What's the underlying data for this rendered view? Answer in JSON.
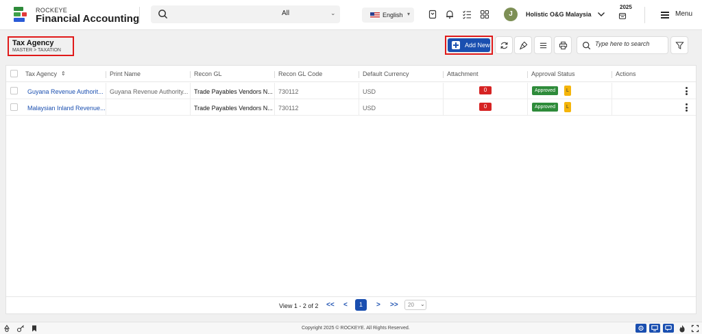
{
  "app": {
    "brand_small": "ROCKEYE",
    "brand_main": "Financial Accounting"
  },
  "topbar": {
    "search_scope": "All",
    "language": "English",
    "avatar_initial": "J",
    "company": "Holistic O&G Malaysia",
    "year": "2025",
    "menu_label": "Menu"
  },
  "page": {
    "title": "Tax Agency",
    "breadcrumb": "MASTER  >  TAXATION",
    "add_new_label": "Add New",
    "search_placeholder": "Type here to search"
  },
  "table": {
    "columns": [
      "Tax Agency",
      "Print Name",
      "Recon GL",
      "Recon GL Code",
      "Default Currency",
      "Attachment",
      "Approval Status",
      "Actions"
    ],
    "sort_indicator": "⇕",
    "rows": [
      {
        "tax_agency": "Guyana Revenue Authorit...",
        "print_name": "Guyana Revenue Authority...",
        "recon_gl": "Trade Payables Vendors N...",
        "recon_gl_code": "730112",
        "currency": "USD",
        "attachment": "0",
        "status": "Approved",
        "lock": "L"
      },
      {
        "tax_agency": "Malaysian Inland Revenue...",
        "print_name": "",
        "recon_gl": "Trade Payables Vendors N...",
        "recon_gl_code": "730112",
        "currency": "USD",
        "attachment": "0",
        "status": "Approved",
        "lock": "L"
      }
    ]
  },
  "pagination": {
    "summary": "View 1 - 2 of 2",
    "first": "<<",
    "prev": "<",
    "current": "1",
    "next": ">",
    "last": ">>",
    "page_size": "20"
  },
  "footer": {
    "copyright": "Copyright 2025 © ROCKEYE. All Rights Reserved."
  },
  "colors": {
    "primary": "#1a4fb0",
    "approved": "#2e8b3a",
    "attachment": "#d62323",
    "lock": "#f5b50a",
    "highlight": "#e01818"
  }
}
